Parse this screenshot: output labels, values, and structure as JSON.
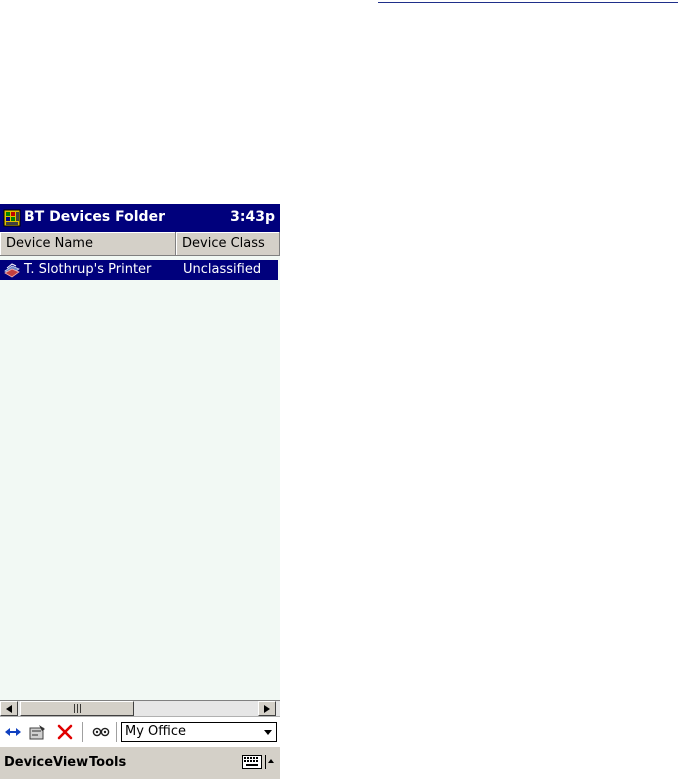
{
  "titlebar": {
    "title": "BT Devices Folder",
    "time": "3:43p"
  },
  "columns": {
    "name": "Device Name",
    "class": "Device Class"
  },
  "devices": [
    {
      "name": "T. Slothrup's Printer",
      "class": "Unclassified",
      "selected": true
    }
  ],
  "toolbar": {
    "icons": [
      "connect-icon",
      "properties-icon",
      "delete-icon",
      "discover-icon"
    ],
    "profile_select": "My Office"
  },
  "menubar": {
    "items": [
      "Device",
      "View",
      "Tools"
    ]
  },
  "colors": {
    "titlebar": "#00007c",
    "selection": "#00007c",
    "list_bg": "#f2f9f4",
    "chrome": "#d4d0c8"
  }
}
